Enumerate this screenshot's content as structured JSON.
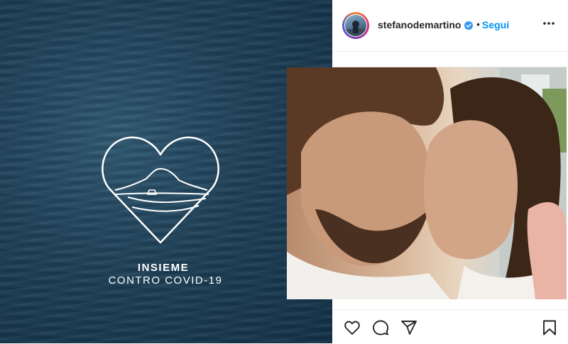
{
  "campaign": {
    "line1": "INSIEME",
    "line2": "CONTRO COVID-19"
  },
  "post": {
    "username": "stefanodemartino",
    "separator": "•",
    "follow_label": "Segui",
    "verified": true,
    "more_icon": "more-horizontal-icon"
  },
  "actions": {
    "icons": [
      "heart-icon",
      "comment-icon",
      "share-icon",
      "bookmark-icon"
    ]
  },
  "photo": {
    "description_icon": "couple-photo"
  },
  "colors": {
    "ocean": "#1e4159",
    "accent_blue": "#0095f6",
    "verified_blue": "#3897f0",
    "text": "#262626"
  }
}
